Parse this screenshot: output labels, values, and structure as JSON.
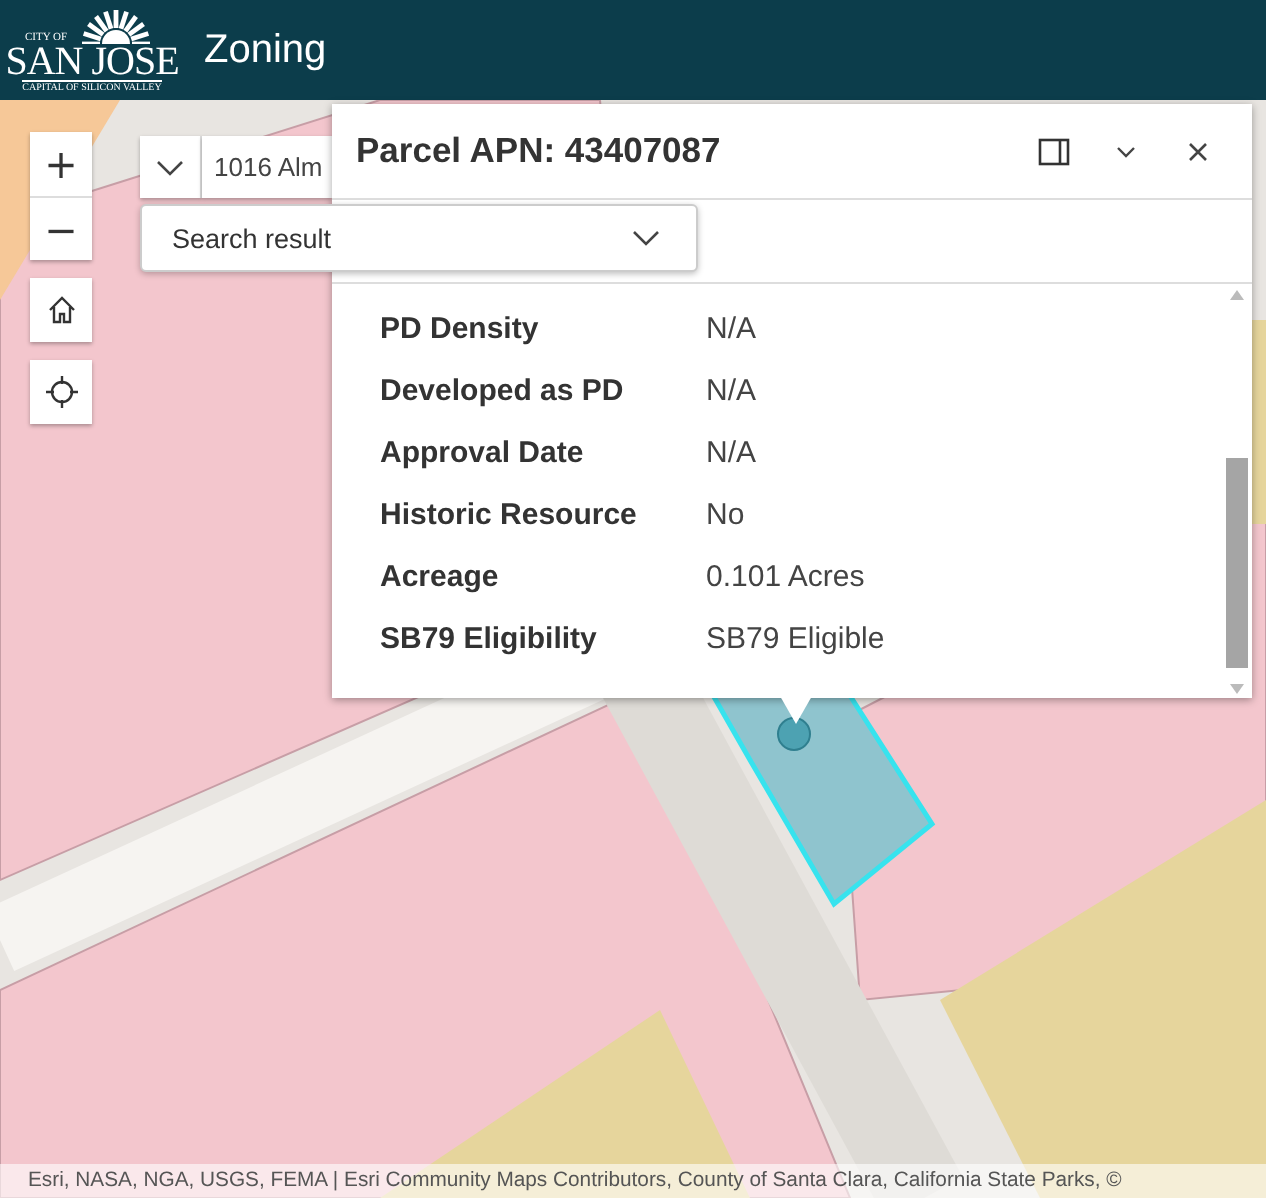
{
  "header": {
    "logo": {
      "top": "CITY OF",
      "main": "SAN JOSE",
      "tagline": "CAPITAL OF SILICON VALLEY"
    },
    "title": "Zoning"
  },
  "zoom_controls": [
    {
      "symbol": "+"
    },
    {
      "symbol": "−"
    }
  ],
  "search": {
    "value": "1016 Alm",
    "source": "Search result"
  },
  "popup": {
    "title": "Parcel APN: 43407087",
    "fields": [
      {
        "label": "PD Density",
        "value": "N/A"
      },
      {
        "label": "Developed as PD",
        "value": "N/A"
      },
      {
        "label": "Approval Date",
        "value": "N/A"
      },
      {
        "label": "Historic Resource",
        "value": "No"
      },
      {
        "label": "Acreage",
        "value": "0.101 Acres"
      },
      {
        "label": "SB79 Eligibility",
        "value": "SB79 Eligible"
      }
    ]
  },
  "attribution": "Esri, NASA, NGA, USGS, FEMA | Esri Community Maps Contributors, County of Santa Clara, California State Parks, ©"
}
